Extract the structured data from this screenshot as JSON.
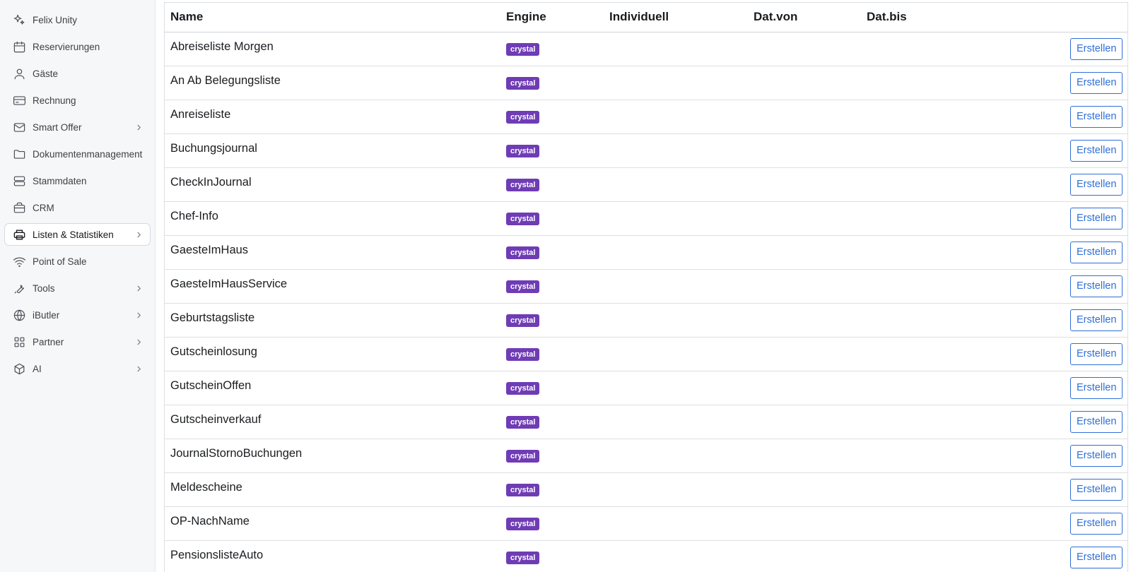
{
  "sidebar": {
    "items": [
      {
        "label": "Felix Unity",
        "icon": "sparkle-icon",
        "chevron": false,
        "active": false
      },
      {
        "label": "Reservierungen",
        "icon": "calendar-icon",
        "chevron": false,
        "active": false
      },
      {
        "label": "Gäste",
        "icon": "user-icon",
        "chevron": false,
        "active": false
      },
      {
        "label": "Rechnung",
        "icon": "credit-card-icon",
        "chevron": false,
        "active": false
      },
      {
        "label": "Smart Offer",
        "icon": "mail-icon",
        "chevron": true,
        "active": false
      },
      {
        "label": "Dokumentenmanagement",
        "icon": "folder-icon",
        "chevron": false,
        "active": false
      },
      {
        "label": "Stammdaten",
        "icon": "server-icon",
        "chevron": false,
        "active": false
      },
      {
        "label": "CRM",
        "icon": "briefcase-icon",
        "chevron": false,
        "active": false
      },
      {
        "label": "Listen & Statistiken",
        "icon": "printer-icon",
        "chevron": true,
        "active": true
      },
      {
        "label": "Point of Sale",
        "icon": "wifi-icon",
        "chevron": false,
        "active": false
      },
      {
        "label": "Tools",
        "icon": "wrench-icon",
        "chevron": true,
        "active": false
      },
      {
        "label": "iButler",
        "icon": "globe-icon",
        "chevron": true,
        "active": false
      },
      {
        "label": "Partner",
        "icon": "grid-icon",
        "chevron": true,
        "active": false
      },
      {
        "label": "AI",
        "icon": "cube-icon",
        "chevron": true,
        "active": false
      }
    ]
  },
  "table": {
    "headers": {
      "name": "Name",
      "engine": "Engine",
      "individuell": "Individuell",
      "dat_von": "Dat.von",
      "dat_bis": "Dat.bis",
      "action": ""
    },
    "action_label": "Erstellen",
    "badge_color": "#6f3cb5",
    "button_color": "#2f6fd6",
    "rows": [
      {
        "name": "Abreiseliste Morgen",
        "engine": "crystal"
      },
      {
        "name": "An Ab Belegungsliste",
        "engine": "crystal"
      },
      {
        "name": "Anreiseliste",
        "engine": "crystal"
      },
      {
        "name": "Buchungsjournal",
        "engine": "crystal"
      },
      {
        "name": "CheckInJournal",
        "engine": "crystal"
      },
      {
        "name": "Chef-Info",
        "engine": "crystal"
      },
      {
        "name": "GaesteImHaus",
        "engine": "crystal"
      },
      {
        "name": "GaesteImHausService",
        "engine": "crystal"
      },
      {
        "name": "Geburtstagsliste",
        "engine": "crystal"
      },
      {
        "name": "Gutscheinlosung",
        "engine": "crystal"
      },
      {
        "name": "GutscheinOffen",
        "engine": "crystal"
      },
      {
        "name": "Gutscheinverkauf",
        "engine": "crystal"
      },
      {
        "name": "JournalStornoBuchungen",
        "engine": "crystal"
      },
      {
        "name": "Meldescheine",
        "engine": "crystal"
      },
      {
        "name": "OP-NachName",
        "engine": "crystal"
      },
      {
        "name": "PensionslisteAuto",
        "engine": "crystal"
      }
    ]
  }
}
